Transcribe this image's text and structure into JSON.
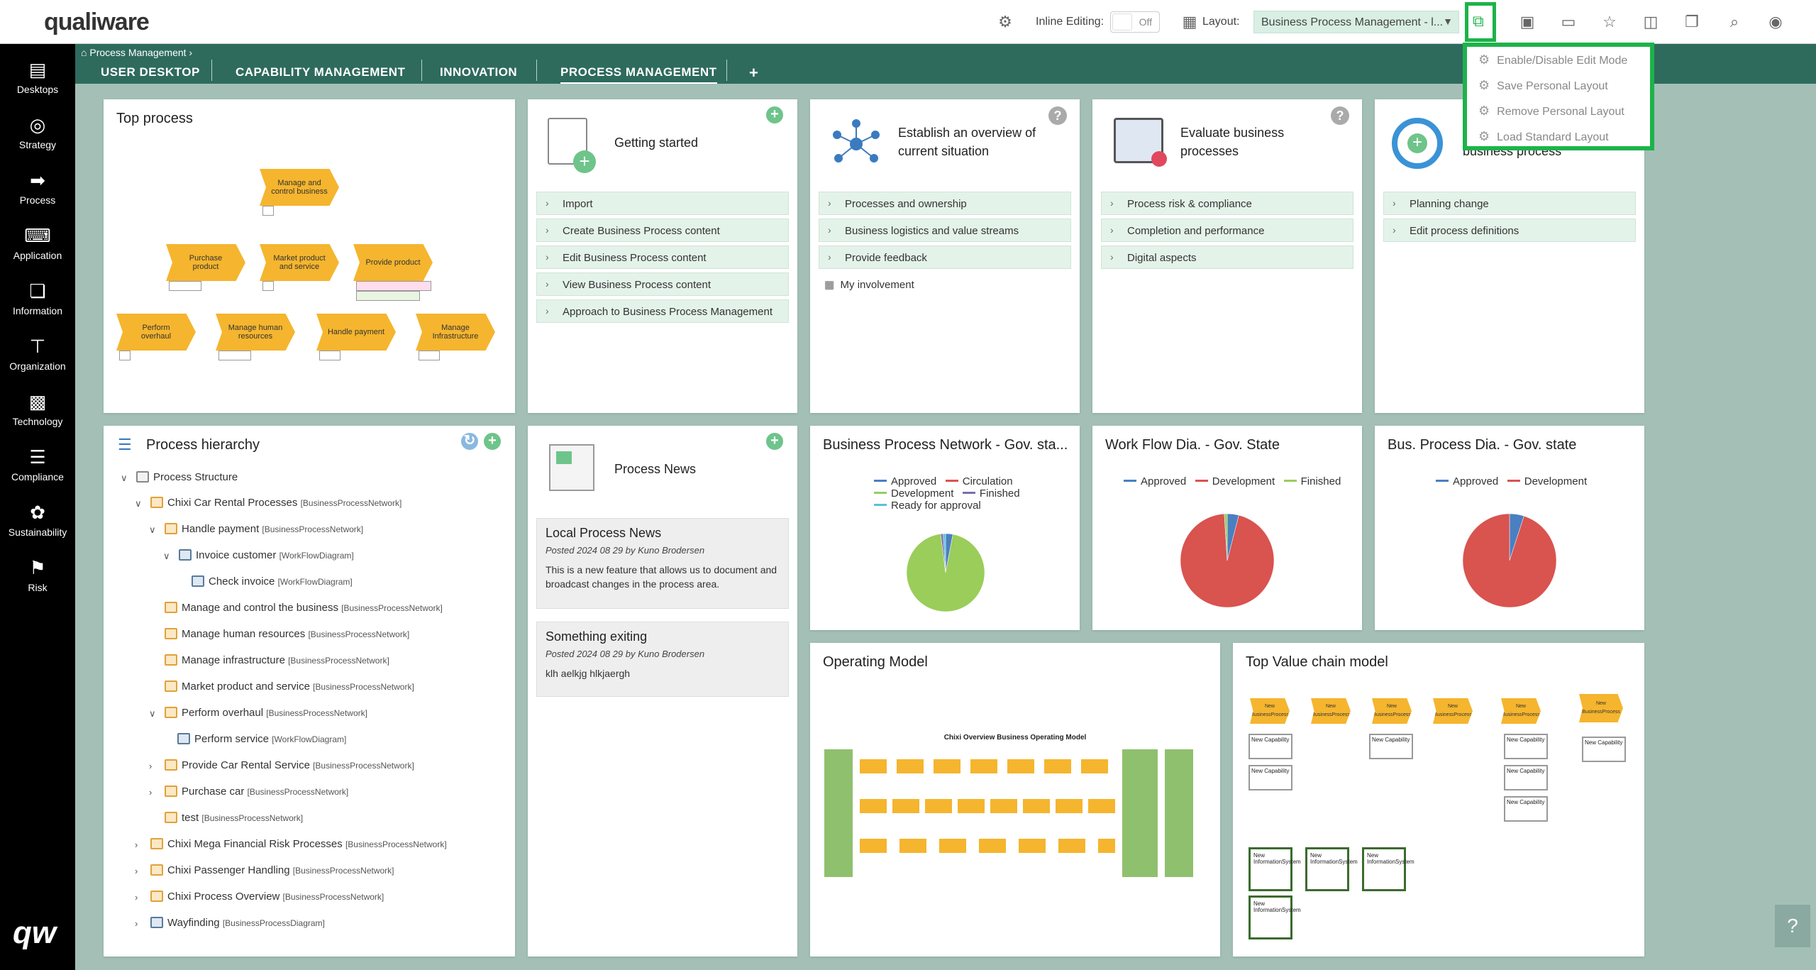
{
  "app": {
    "logo": "qualiware"
  },
  "topbar": {
    "inline_editing_label": "Inline Editing:",
    "inline_editing_value": "Off",
    "layout_label": "Layout:",
    "layout_value": "Business Process Management - l..."
  },
  "dropdown": {
    "items": [
      "Enable/Disable Edit Mode",
      "Save Personal Layout",
      "Remove Personal Layout",
      "Load Standard Layout"
    ]
  },
  "sidebar": {
    "items": [
      {
        "label": "Desktops",
        "icon": "desktops-icon"
      },
      {
        "label": "Strategy",
        "icon": "strategy-icon"
      },
      {
        "label": "Process",
        "icon": "process-icon"
      },
      {
        "label": "Application",
        "icon": "application-icon"
      },
      {
        "label": "Information",
        "icon": "information-icon"
      },
      {
        "label": "Organization",
        "icon": "organization-icon"
      },
      {
        "label": "Technology",
        "icon": "technology-icon"
      },
      {
        "label": "Compliance",
        "icon": "compliance-icon"
      },
      {
        "label": "Sustainability",
        "icon": "sustainability-icon"
      },
      {
        "label": "Risk",
        "icon": "risk-icon"
      }
    ],
    "bottom_logo": "qw"
  },
  "tabs": {
    "breadcrumb": "Process Management",
    "items": [
      "USER DESKTOP",
      "CAPABILITY MANAGEMENT",
      "INNOVATION",
      "PROCESS MANAGEMENT"
    ],
    "add": "+"
  },
  "top_process": {
    "title": "Top process",
    "shapes": [
      "Manage and control business",
      "Purchase product",
      "Market product and service",
      "Provide product",
      "Perform overhaul",
      "Manage human resources",
      "Handle payment",
      "Manage Infrastructure"
    ]
  },
  "getting_started": {
    "title": "Getting started",
    "items": [
      "Import",
      "Create Business Process content",
      "Edit Business Process content",
      "View Business Process content",
      "Approach to Business Process Management"
    ]
  },
  "overview": {
    "title": "Establish an overview of current situation",
    "items": [
      "Processes and ownership",
      "Business logistics and value streams",
      "Provide feedback"
    ],
    "extra": "My involvement"
  },
  "evaluate": {
    "title": "Evaluate business processes",
    "items": [
      "Process risk & compliance",
      "Completion and performance",
      "Digital aspects"
    ]
  },
  "change": {
    "title": "business process",
    "items": [
      "Planning change",
      "Edit process definitions"
    ]
  },
  "hierarchy": {
    "title": "Process hierarchy",
    "root": "Process Structure",
    "rows": [
      {
        "name": "Chixi Car Rental Processes",
        "type": "[BusinessProcessNetwork]"
      },
      {
        "name": "Handle payment",
        "type": "[BusinessProcessNetwork]"
      },
      {
        "name": "Invoice customer",
        "type": "[WorkFlowDiagram]"
      },
      {
        "name": "Check invoice",
        "type": "[WorkFlowDiagram]"
      },
      {
        "name": "Manage and control the business",
        "type": "[BusinessProcessNetwork]"
      },
      {
        "name": "Manage human resources",
        "type": "[BusinessProcessNetwork]"
      },
      {
        "name": "Manage infrastructure",
        "type": "[BusinessProcessNetwork]"
      },
      {
        "name": "Market product and service",
        "type": "[BusinessProcessNetwork]"
      },
      {
        "name": "Perform overhaul",
        "type": "[BusinessProcessNetwork]"
      },
      {
        "name": "Perform service",
        "type": "[WorkFlowDiagram]"
      },
      {
        "name": "Provide Car Rental Service",
        "type": "[BusinessProcessNetwork]"
      },
      {
        "name": "Purchase car",
        "type": "[BusinessProcessNetwork]"
      },
      {
        "name": "test",
        "type": "[BusinessProcessNetwork]"
      },
      {
        "name": "Chixi Mega Financial Risk Processes",
        "type": "[BusinessProcessNetwork]"
      },
      {
        "name": "Chixi Passenger Handling",
        "type": "[BusinessProcessNetwork]"
      },
      {
        "name": "Chixi Process Overview",
        "type": "[BusinessProcessNetwork]"
      },
      {
        "name": "Wayfinding",
        "type": "[BusinessProcessDiagram]"
      }
    ]
  },
  "news": {
    "title": "Process News",
    "posts": [
      {
        "title": "Local Process News",
        "meta": "Posted 2024 08 29 by Kuno Brodersen",
        "body": "This is a new feature that allows us to document and broadcast changes in the process area."
      },
      {
        "title": "Something exiting",
        "meta": "Posted 2024 08 29 by Kuno Brodersen",
        "body": "klh aelkjg hlkjaergh"
      }
    ]
  },
  "charts": {
    "network": {
      "title": "Business Process Network - Gov. sta...",
      "legend": [
        "Approved",
        "Circulation",
        "Development",
        "Finished",
        "Ready for approval"
      ]
    },
    "workflow": {
      "title": "Work Flow Dia. - Gov. State",
      "legend": [
        "Approved",
        "Development",
        "Finished"
      ]
    },
    "busproc": {
      "title": "Bus. Process Dia. - Gov. state",
      "legend": [
        "Approved",
        "Development"
      ]
    }
  },
  "chart_data": [
    {
      "type": "pie",
      "title": "Business Process Network - Gov. sta...",
      "categories": [
        "Approved",
        "Circulation",
        "Development",
        "Finished",
        "Ready for approval"
      ],
      "values": [
        3,
        0,
        95,
        1,
        1
      ],
      "colors": [
        "#4a7fc1",
        "#d9534f",
        "#9acd5a",
        "#7a6fae",
        "#5bc0de"
      ]
    },
    {
      "type": "pie",
      "title": "Work Flow Dia. - Gov. State",
      "categories": [
        "Approved",
        "Development",
        "Finished"
      ],
      "values": [
        4,
        95,
        1
      ],
      "colors": [
        "#4a7fc1",
        "#d9534f",
        "#9acd5a"
      ]
    },
    {
      "type": "pie",
      "title": "Bus. Process Dia. - Gov. state",
      "categories": [
        "Approved",
        "Development"
      ],
      "values": [
        5,
        95
      ],
      "colors": [
        "#4a7fc1",
        "#d9534f"
      ]
    }
  ],
  "operating_model": {
    "title": "Operating Model",
    "diagram_title": "Chixi Overview Business Operating Model"
  },
  "value_chain": {
    "title": "Top Value chain model",
    "shape_label": "New BusinessProcess",
    "cap_label": "New Capability",
    "is_label": "New InformationSystem"
  },
  "colors": {
    "accent": "#1db34a",
    "tabbar": "#2e6b5d",
    "background": "#a4c0b6"
  }
}
